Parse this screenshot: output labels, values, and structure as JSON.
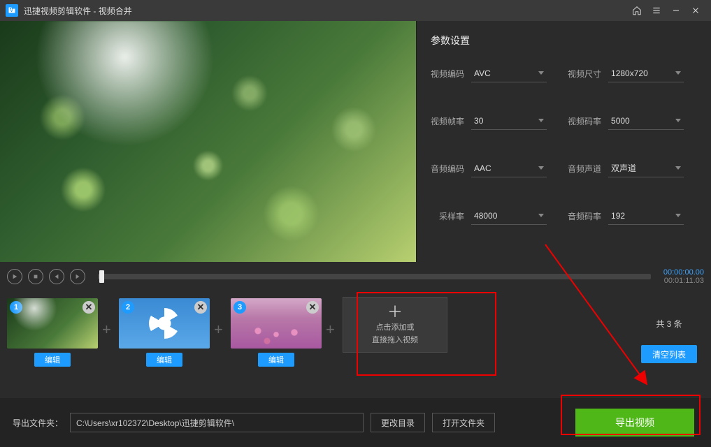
{
  "titlebar": {
    "app_name": "迅捷视频剪辑软件",
    "subtitle": "视频合并"
  },
  "settings": {
    "title": "参数设置",
    "video_codec": {
      "label": "视频编码",
      "value": "AVC"
    },
    "video_size": {
      "label": "视频尺寸",
      "value": "1280x720"
    },
    "video_fps": {
      "label": "视频帧率",
      "value": "30"
    },
    "video_bitrate": {
      "label": "视频码率",
      "value": "5000"
    },
    "audio_codec": {
      "label": "音频编码",
      "value": "AAC"
    },
    "audio_channels": {
      "label": "音频声道",
      "value": "双声道"
    },
    "sample_rate": {
      "label": "采样率",
      "value": "48000"
    },
    "audio_bitrate": {
      "label": "音频码率",
      "value": "192"
    }
  },
  "player": {
    "current": "00:00:00.00",
    "total": "00:01:11.03"
  },
  "clips": {
    "items": [
      {
        "index": "1",
        "edit": "编辑"
      },
      {
        "index": "2",
        "edit": "编辑"
      },
      {
        "index": "3",
        "edit": "编辑"
      }
    ],
    "add_line1": "点击添加或",
    "add_line2": "直接拖入视频",
    "count": "共 3 条",
    "clear": "清空列表"
  },
  "footer": {
    "out_label": "导出文件夹：",
    "out_path": "C:\\Users\\xr102372\\Desktop\\迅捷剪辑软件\\",
    "change_dir": "更改目录",
    "open_dir": "打开文件夹",
    "export": "导出视频"
  }
}
